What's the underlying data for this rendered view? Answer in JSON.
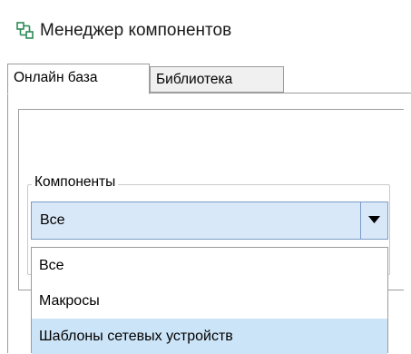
{
  "window": {
    "title": "Менеджер компонентов",
    "icon": "component-manager-icon"
  },
  "tabs": [
    {
      "label": "Онлайн база",
      "active": true
    },
    {
      "label": "Библиотека",
      "active": false
    }
  ],
  "components_group": {
    "label": "Компоненты",
    "combo": {
      "selected": "Все",
      "expanded": true,
      "options": [
        "Все",
        "Макросы",
        "Шаблоны сетевых устройств"
      ],
      "highlighted_option": "Шаблоны сетевых устройств"
    }
  },
  "colors": {
    "selection": "#cce4f7",
    "combo_bg": "#d9e8f8",
    "icon_accent": "#2e8b57"
  }
}
